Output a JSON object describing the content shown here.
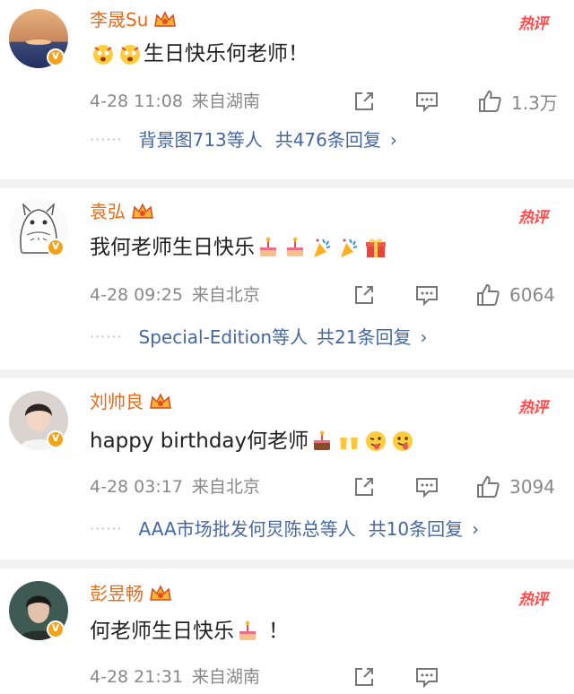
{
  "comments": [
    {
      "username": "李晟Su",
      "hot_label": "热评",
      "text_before": "",
      "text": "生日快乐何老师！",
      "leading_emojis": [
        "awe-face-emoji",
        "awe-face-emoji"
      ],
      "trailing_emojis": [],
      "time": "4-28 11:08",
      "location": "来自湖南",
      "likes": "1.3万",
      "reply_users": "背景图713等人",
      "reply_count": "共476条回复"
    },
    {
      "username": "袁弘",
      "hot_label": "热评",
      "text": "我何老师生日快乐",
      "leading_emojis": [],
      "trailing_emojis": [
        "cake-emoji",
        "cake-emoji",
        "confetti-emoji",
        "confetti-emoji",
        "gift-emoji"
      ],
      "time": "4-28 09:25",
      "location": "来自北京",
      "likes": "6064",
      "reply_users": "Special-Edition等人",
      "reply_count": "共21条回复"
    },
    {
      "username": "刘帅良",
      "hot_label": "热评",
      "text": "happy birthday何老师",
      "leading_emojis": [],
      "trailing_emojis": [
        "cake-emoji",
        "cheers-emoji",
        "wink-tongue-emoji",
        "tongue-emoji"
      ],
      "time": "4-28 03:17",
      "location": "来自北京",
      "likes": "3094",
      "reply_users": "AAA市场批发何炅陈总等人",
      "reply_count": "共10条回复"
    },
    {
      "username": "彭昱畅",
      "hot_label": "热评",
      "text": "何老师生日快乐",
      "leading_emojis": [],
      "trailing_emojis": [
        "cake-emoji"
      ],
      "text_after": "！",
      "time": "4-28 21:31",
      "location": "来自湖南",
      "likes": "",
      "reply_users": "",
      "reply_count": ""
    }
  ],
  "colors": {
    "username": "#e86b1a",
    "hot": "#ff4a4a",
    "link": "#45679e",
    "meta": "#888888",
    "badge": "#f3a21b"
  },
  "icons": {
    "share": "share-icon",
    "comment": "comment-icon",
    "like": "thumbs-up-icon",
    "crown": "crown-badge-icon",
    "verified": "verified-v-badge-icon"
  }
}
